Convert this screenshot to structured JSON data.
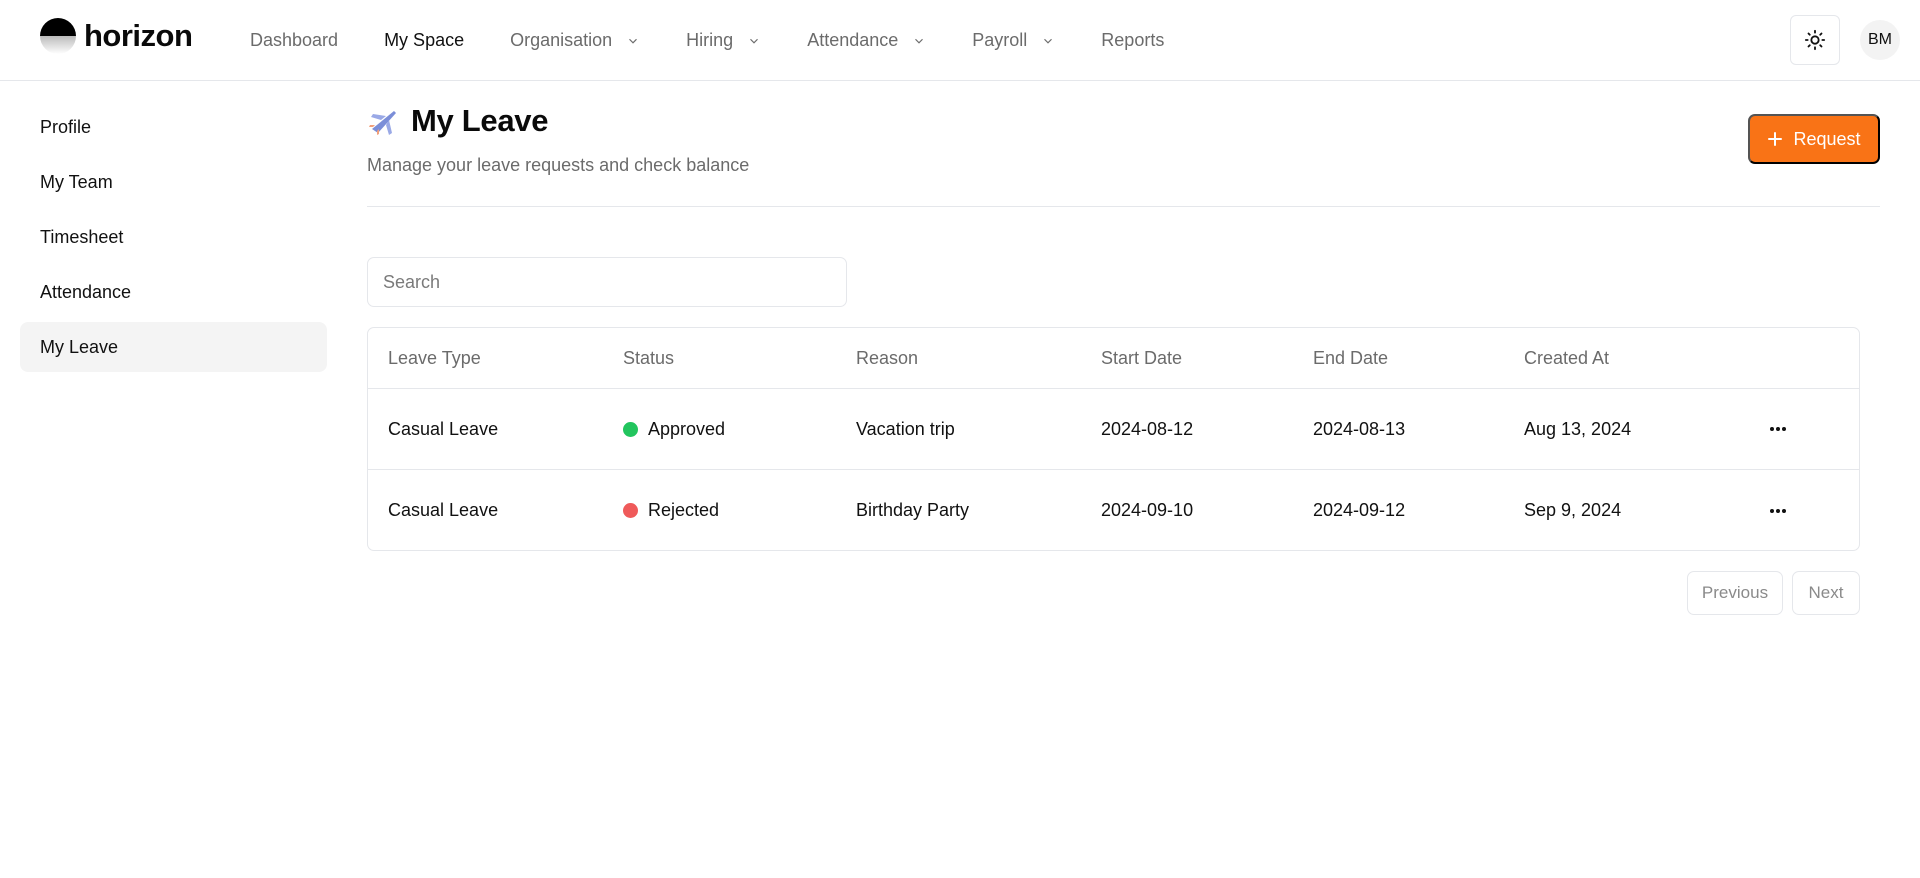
{
  "brand": {
    "name": "horizon"
  },
  "nav": {
    "items": [
      {
        "label": "Dashboard",
        "dropdown": false,
        "active": false
      },
      {
        "label": "My Space",
        "dropdown": false,
        "active": true
      },
      {
        "label": "Organisation",
        "dropdown": true,
        "active": false
      },
      {
        "label": "Hiring",
        "dropdown": true,
        "active": false
      },
      {
        "label": "Attendance",
        "dropdown": true,
        "active": false
      },
      {
        "label": "Payroll",
        "dropdown": true,
        "active": false
      },
      {
        "label": "Reports",
        "dropdown": false,
        "active": false
      }
    ]
  },
  "header": {
    "theme_icon": "sun-icon",
    "avatar_initials": "BM"
  },
  "sidebar": {
    "items": [
      {
        "label": "Profile",
        "active": false
      },
      {
        "label": "My Team",
        "active": false
      },
      {
        "label": "Timesheet",
        "active": false
      },
      {
        "label": "Attendance",
        "active": false
      },
      {
        "label": "My Leave",
        "active": true
      }
    ]
  },
  "page": {
    "icon": "airplane-icon",
    "title": "My Leave",
    "subtitle": "Manage your leave requests and check balance",
    "request_label": "Request"
  },
  "search": {
    "placeholder": "Search",
    "value": ""
  },
  "table": {
    "columns": [
      "Leave Type",
      "Status",
      "Reason",
      "Start Date",
      "End Date",
      "Created At"
    ],
    "rows": [
      {
        "leave_type": "Casual Leave",
        "status": "Approved",
        "status_color": "#22c55e",
        "reason": "Vacation trip",
        "start_date": "2024-08-12",
        "end_date": "2024-08-13",
        "created_at": "Aug 13, 2024"
      },
      {
        "leave_type": "Casual Leave",
        "status": "Rejected",
        "status_color": "#ef5a5a",
        "reason": "Birthday Party",
        "start_date": "2024-09-10",
        "end_date": "2024-09-12",
        "created_at": "Sep 9, 2024"
      }
    ]
  },
  "pagination": {
    "previous_label": "Previous",
    "next_label": "Next"
  },
  "colors": {
    "accent": "#f97316",
    "border": "#e5e7eb",
    "muted_text": "#6b6b6b"
  }
}
